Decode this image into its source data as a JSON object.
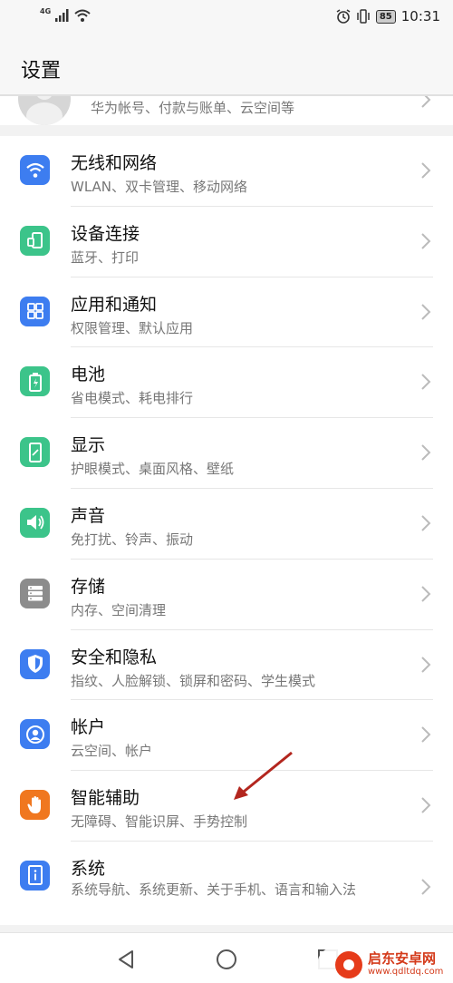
{
  "status_bar": {
    "network": "4G",
    "battery": "85",
    "time": "10:31"
  },
  "header": {
    "title": "设置"
  },
  "account": {
    "subtitle": "华为帐号、付款与账单、云空间等"
  },
  "settings": [
    {
      "title": "无线和网络",
      "subtitle": "WLAN、双卡管理、移动网络",
      "icon": "wifi-icon",
      "color": "#3d7df0"
    },
    {
      "title": "设备连接",
      "subtitle": "蓝牙、打印",
      "icon": "device-connection-icon",
      "color": "#3cc48a"
    },
    {
      "title": "应用和通知",
      "subtitle": "权限管理、默认应用",
      "icon": "apps-icon",
      "color": "#3d7df0"
    },
    {
      "title": "电池",
      "subtitle": "省电模式、耗电排行",
      "icon": "battery-icon",
      "color": "#3cc48a"
    },
    {
      "title": "显示",
      "subtitle": "护眼模式、桌面风格、壁纸",
      "icon": "display-icon",
      "color": "#3cc48a"
    },
    {
      "title": "声音",
      "subtitle": "免打扰、铃声、振动",
      "icon": "sound-icon",
      "color": "#3cc48a"
    },
    {
      "title": "存储",
      "subtitle": "内存、空间清理",
      "icon": "storage-icon",
      "color": "#8c8c8c"
    },
    {
      "title": "安全和隐私",
      "subtitle": "指纹、人脸解锁、锁屏和密码、学生模式",
      "icon": "security-icon",
      "color": "#3d7df0"
    },
    {
      "title": "帐户",
      "subtitle": "云空间、帐户",
      "icon": "account-icon",
      "color": "#3d7df0"
    },
    {
      "title": "智能辅助",
      "subtitle": "无障碍、智能识屏、手势控制",
      "icon": "hand-icon",
      "color": "#f0771f"
    },
    {
      "title": "系统",
      "subtitle": "系统导航、系统更新、关于手机、语言和输入法",
      "icon": "system-icon",
      "color": "#3d7df0"
    }
  ],
  "watermark": {
    "title": "启东安卓网",
    "url": "www.qdltdq.com"
  }
}
